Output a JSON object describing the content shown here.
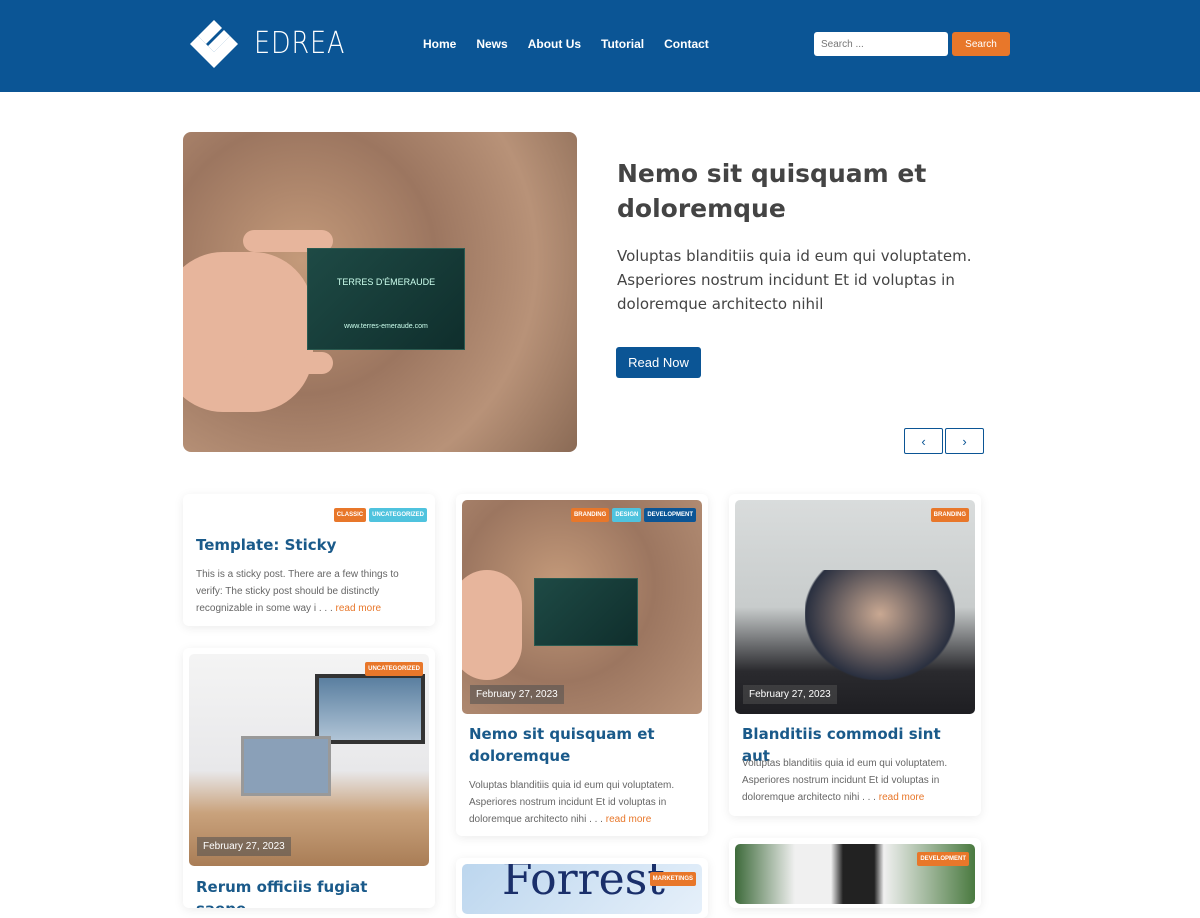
{
  "header": {
    "brand": "EDREA",
    "nav": [
      "Home",
      "News",
      "About Us",
      "Tutorial",
      "Contact"
    ],
    "search_placeholder": "Search ...",
    "search_button": "Search"
  },
  "hero": {
    "title": "Nemo sit quisquam et doloremque",
    "text": "Voluptas blanditiis quia id eum qui voluptatem. Asperiores nostrum incidunt Et id voluptas in doloremque architecto nihil",
    "button": "Read Now",
    "card_text": "TERRES D'ÉMERAUDE",
    "card_url": "www.terres-emeraude.com",
    "prev": "‹",
    "next": "›"
  },
  "colors": {
    "brand": "#0b5595",
    "accent": "#e8772a",
    "tag_light": "#4fc3de"
  },
  "posts": [
    {
      "tags": [
        "Classic",
        "Uncategorized"
      ],
      "title": "Template: Sticky",
      "excerpt": "This is a sticky post. There are a few things to verify: The sticky post should be distinctly recognizable in some way i . . . ",
      "more": "read more"
    },
    {
      "tags": [
        "Branding",
        "Design",
        "Development"
      ],
      "date": "February 27, 2023",
      "title": "Nemo sit quisquam et doloremque",
      "excerpt": "Voluptas blanditiis quia id eum qui voluptatem. Asperiores nostrum incidunt Et id voluptas in doloremque architecto nihi . . . ",
      "more": "read more"
    },
    {
      "tags": [
        "Branding"
      ],
      "date": "February 27, 2023",
      "title": "Blanditiis commodi sint aut",
      "excerpt": "Voluptas blanditiis quia id eum qui voluptatem. Asperiores nostrum incidunt Et id voluptas in doloremque architecto nihi . . . ",
      "more": "read more"
    },
    {
      "tags": [
        "Uncategorized"
      ],
      "date": "February 27, 2023",
      "title": "Rerum officiis fugiat saepe"
    },
    {
      "tags": [
        "Marketings"
      ],
      "image_text": "Forrest"
    },
    {
      "tags": [
        "Development"
      ]
    }
  ]
}
